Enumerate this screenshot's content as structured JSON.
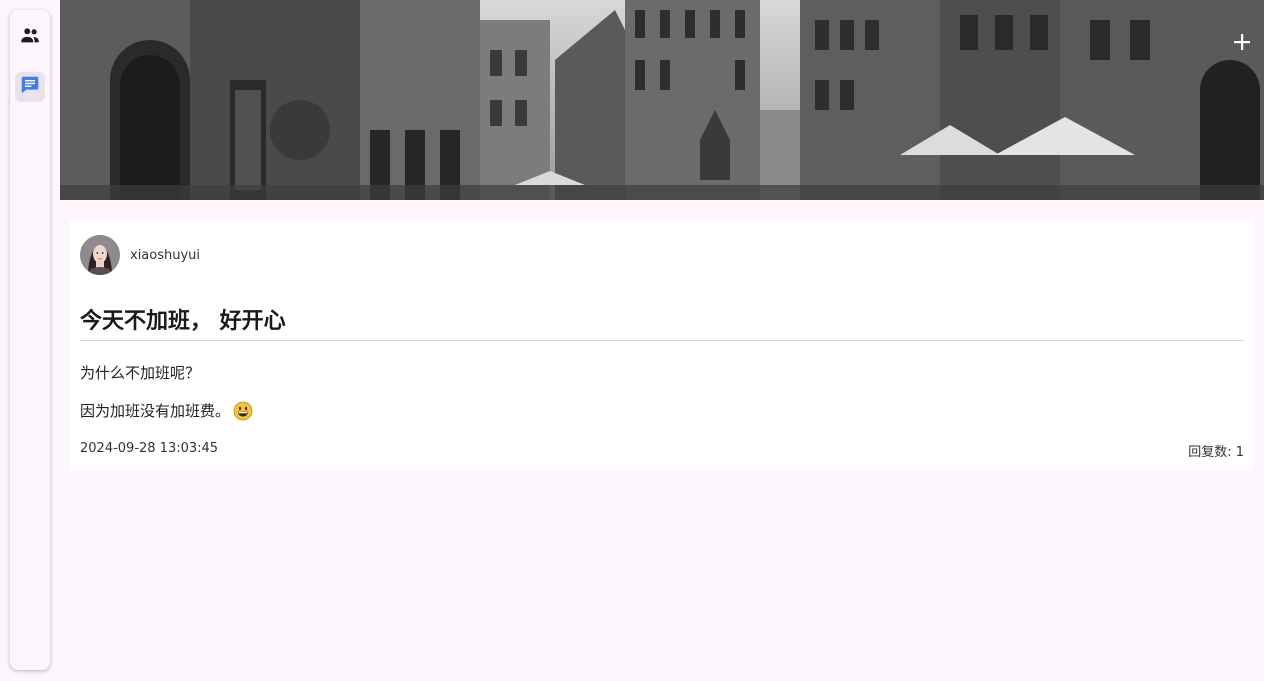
{
  "rail": {
    "items": [
      {
        "icon": "people-icon",
        "active": false
      },
      {
        "icon": "chat-icon",
        "active": true
      }
    ]
  },
  "banner": {
    "image": "black-and-white old town street with church tower",
    "add_icon": "plus-icon"
  },
  "post": {
    "author": "xiaoshuyui",
    "title": "今天不加班， 好开心",
    "paragraphs": [
      "为什么不加班呢？",
      "因为加班没有加班费。"
    ],
    "emoji": "grinning-face-emoji",
    "timestamp": "2024-09-28 13:03:45",
    "reply_count": "回复数: 1"
  },
  "colors": {
    "background": "#fdf7fd",
    "accent": "#3f7cf0",
    "card": "#ffffff"
  }
}
